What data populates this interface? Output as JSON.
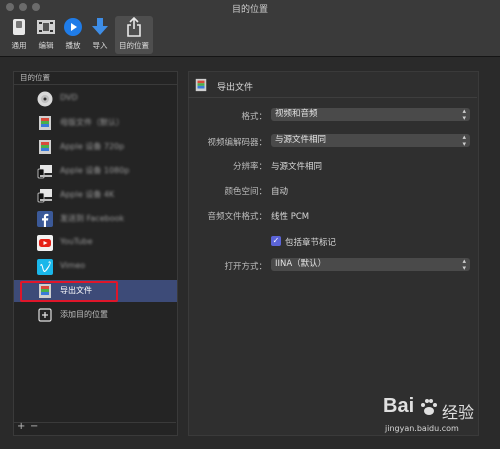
{
  "window": {
    "title": "目的位置"
  },
  "toolbar": {
    "items": [
      {
        "label": "通用",
        "icon": "switch-icon"
      },
      {
        "label": "编辑",
        "icon": "film-edit-icon"
      },
      {
        "label": "播放",
        "icon": "play-icon"
      },
      {
        "label": "导入",
        "icon": "download-arrow-icon"
      },
      {
        "label": "目的位置",
        "icon": "share-icon"
      }
    ]
  },
  "sidebar": {
    "header": "目的位置",
    "items": [
      {
        "label": "DVD",
        "icon": "dvd-icon"
      },
      {
        "label": "母版文件（默认）",
        "icon": "film-icon"
      },
      {
        "label": "Apple 设备 720p",
        "icon": "film-icon"
      },
      {
        "label": "Apple 设备 1080p",
        "icon": "devices-icon"
      },
      {
        "label": "Apple 设备 4K",
        "icon": "devices-icon"
      },
      {
        "label": "发送到 Facebook",
        "icon": "facebook-icon"
      },
      {
        "label": "YouTube",
        "icon": "youtube-icon"
      },
      {
        "label": "Vimeo",
        "icon": "vimeo-icon"
      },
      {
        "label": "导出文件",
        "icon": "film-icon"
      },
      {
        "label": "添加目的位置",
        "icon": "plus-box-icon"
      }
    ],
    "footer": {
      "add": "+",
      "remove": "−"
    }
  },
  "panel": {
    "title": "导出文件",
    "format": {
      "label": "格式：",
      "value": "视频和音频"
    },
    "codec": {
      "label": "视频编解码器：",
      "value": "与源文件相同"
    },
    "resolution": {
      "label": "分辨率：",
      "value": "与源文件相同"
    },
    "colorspace": {
      "label": "颜色空间：",
      "value": "自动"
    },
    "audio": {
      "label": "音频文件格式：",
      "value": "线性 PCM"
    },
    "chapters": {
      "label": "包括章节标记",
      "checked": true
    },
    "open_with": {
      "label": "打开方式：",
      "value": "IINA（默认）"
    }
  },
  "watermark": {
    "brand": "Bai",
    "brand_cn": "经验",
    "url": "jingyan.baidu.com"
  },
  "colors": {
    "accent": "#5b64d8",
    "selection": "#3d4b78",
    "highlight_box": "#e0162a"
  }
}
